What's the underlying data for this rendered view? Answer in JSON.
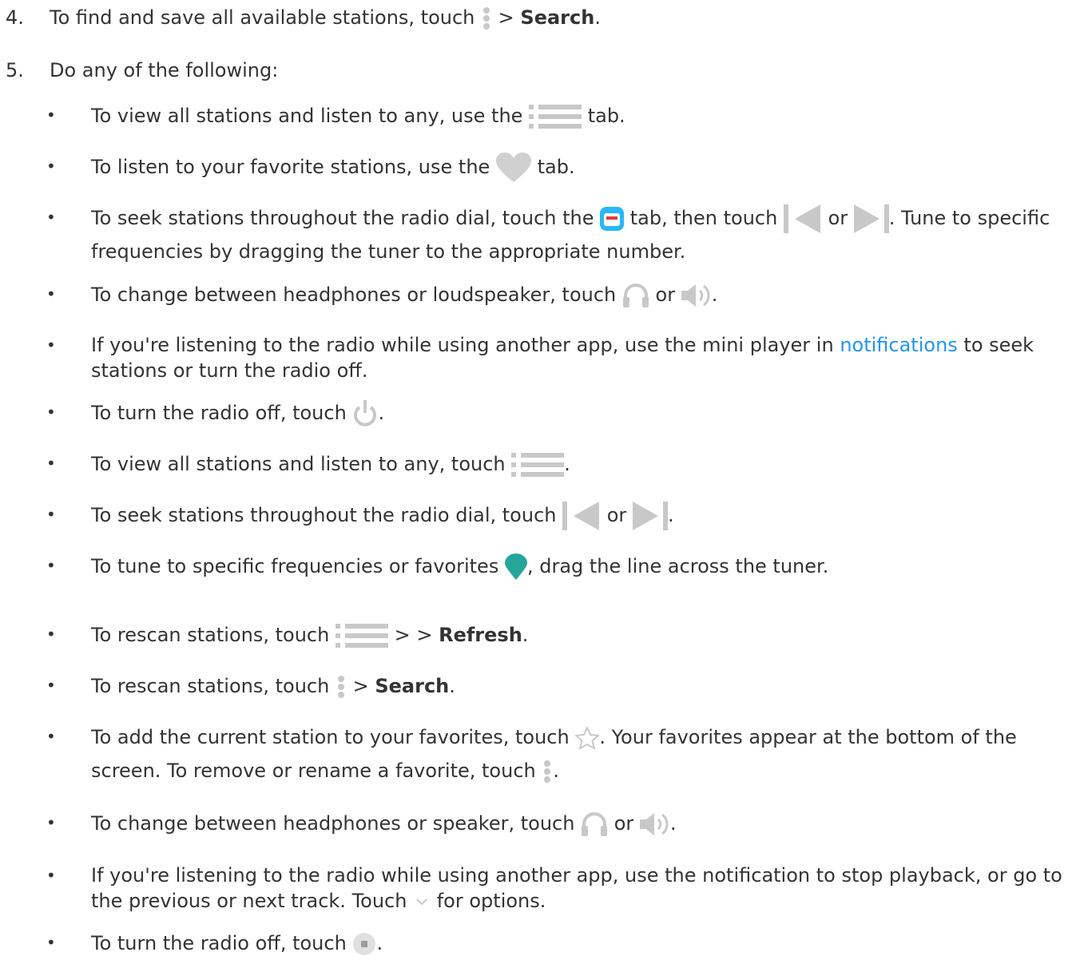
{
  "steps": [
    {
      "number": "4.",
      "text_before": "To find and save all available stations, touch",
      "gt": ">",
      "bold": "Search",
      "end": "."
    },
    {
      "number": "5.",
      "text": "Do any of the following:"
    }
  ],
  "bullets": {
    "b1": {
      "before": "To view all stations and listen to any, use the",
      "after": "tab."
    },
    "b2": {
      "before": "To listen to your favorite stations, use the",
      "after": "tab."
    },
    "b3": {
      "before": "To seek stations throughout the radio dial, touch the",
      "middle": "tab, then touch",
      "or": "or",
      "after": ". Tune to specific frequencies by dragging the tuner to the appropriate number."
    },
    "b4": {
      "before": "To change between headphones or loudspeaker, touch",
      "or": "or",
      "after": "."
    },
    "b5": {
      "before": "If you're listening to the radio while using another app, use the mini player in",
      "link": "notifications",
      "after": "to seek stations or turn the radio off."
    },
    "b6": {
      "before": "To turn the radio off, touch",
      "after": "."
    },
    "b7": {
      "before": "To view all stations and listen to any, touch",
      "after": "."
    },
    "b8": {
      "before": "To seek stations throughout the radio dial, touch",
      "or": "or",
      "after": "."
    },
    "b9": {
      "before": "To tune to specific frequencies or favorites",
      "after": ", drag the line across the tuner."
    },
    "b10": {
      "before": "To rescan stations, touch",
      "gt": "> >",
      "bold": "Refresh",
      "after": "."
    },
    "b11": {
      "before": "To rescan stations, touch",
      "gt": ">",
      "bold": "Search",
      "after": "."
    },
    "b12": {
      "before": "To add the current station to your favorites, touch",
      "after": ". Your favorites appear at the bottom of the screen. To remove or rename a favorite, touch",
      "end": "."
    },
    "b13": {
      "before": "To change between headphones or speaker, touch",
      "or": "or",
      "after": "."
    },
    "b14": {
      "before": "If you're listening to the radio while using another app, use the notification to stop playback, or go to the previous or next track. Touch",
      "after": "for options."
    },
    "b15": {
      "before": "To turn the radio off, touch",
      "after": "."
    }
  },
  "bullet_char": "•",
  "colors": {
    "text": "#333333",
    "link": "#2196f3",
    "icon_gray": "#c8c8c8",
    "favorite_teal": "#26a69a",
    "radio_tab_blue": "#29b6f6",
    "radio_tab_red": "#e53935"
  },
  "icons": [
    "more-vert-icon",
    "list-tab-icon",
    "heart-tab-icon",
    "radio-tab-icon",
    "skip-previous-icon",
    "skip-next-icon",
    "headphones-icon",
    "speaker-icon",
    "power-icon",
    "favorite-marker-icon",
    "star-outline-icon",
    "chevron-down-icon",
    "stop-icon"
  ]
}
